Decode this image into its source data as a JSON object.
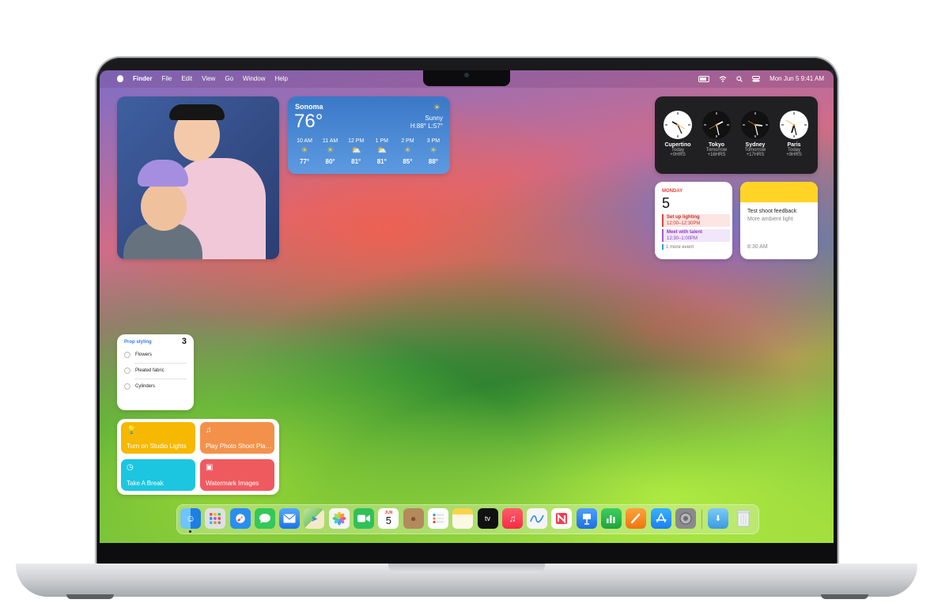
{
  "menubar": {
    "app_name": "Finder",
    "menus": [
      "File",
      "Edit",
      "View",
      "Go",
      "Window",
      "Help"
    ],
    "datetime": "Mon Jun 5  9:41 AM"
  },
  "weather": {
    "city": "Sonoma",
    "temp": "76°",
    "condition": "Sunny",
    "hilo": "H:88° L:57°",
    "hours": [
      {
        "time": "10 AM",
        "temp": "77°",
        "icon": "sun-icon"
      },
      {
        "time": "11 AM",
        "temp": "80°",
        "icon": "sun-icon"
      },
      {
        "time": "12 PM",
        "temp": "81°",
        "icon": "partly-cloudy-icon"
      },
      {
        "time": "1 PM",
        "temp": "81°",
        "icon": "partly-cloudy-icon"
      },
      {
        "time": "2 PM",
        "temp": "85°",
        "icon": "sun-icon"
      },
      {
        "time": "3 PM",
        "temp": "88°",
        "icon": "sun-icon"
      }
    ]
  },
  "clocks": [
    {
      "city": "Cupertino",
      "day": "Today",
      "offset": "+0HRS"
    },
    {
      "city": "Tokyo",
      "day": "Tomorrow",
      "offset": "+16HRS"
    },
    {
      "city": "Sydney",
      "day": "Tomorrow",
      "offset": "+17HRS"
    },
    {
      "city": "Paris",
      "day": "Today",
      "offset": "+9HRS"
    }
  ],
  "calendar": {
    "weekday": "MONDAY",
    "day": "5",
    "events": [
      {
        "name": "Set up lighting",
        "time": "12:00–12:30PM",
        "color": "#e6443a"
      },
      {
        "name": "Meet with talent",
        "time": "12:30–1:00PM",
        "color": "#a35bd6"
      }
    ],
    "more": "1 more event"
  },
  "notes": {
    "title": "Test shoot feedback",
    "body": "More ambient light",
    "time": "8:30 AM"
  },
  "reminders": {
    "list": "Prop styling",
    "count": "3",
    "items": [
      "Flowers",
      "Pleated fabric",
      "Cylinders"
    ]
  },
  "shortcuts": [
    {
      "label": "Turn on Studio Lights",
      "icon": "lightbulb-icon",
      "color": "#f6b800"
    },
    {
      "label": "Play Photo Shoot Playlist",
      "icon": "music-note-icon",
      "color": "#f3914a"
    },
    {
      "label": "Take A Break",
      "icon": "timer-icon",
      "color": "#1cc6e0"
    },
    {
      "label": "Watermark Images",
      "icon": "image-icon",
      "color": "#ef5a5f"
    }
  ],
  "dock": {
    "calendar_month": "JUN",
    "calendar_day": "5",
    "tv_label": "tv",
    "apps": [
      {
        "name": "finder-icon",
        "color": "#2f8be8"
      },
      {
        "name": "launchpad-icon",
        "color": "#d8d8dc"
      },
      {
        "name": "safari-icon",
        "color": "#2a8ef0"
      },
      {
        "name": "messages-icon",
        "color": "#34c759"
      },
      {
        "name": "mail-icon",
        "color": "#3a8ef5"
      },
      {
        "name": "maps-icon",
        "color": "#7ec86a"
      },
      {
        "name": "photos-icon",
        "color": "#f5f5f5"
      },
      {
        "name": "facetime-icon",
        "color": "#30c159"
      },
      {
        "name": "calendar-icon",
        "color": "#ffffff"
      },
      {
        "name": "contacts-icon",
        "color": "#b48a5c"
      },
      {
        "name": "reminders-icon",
        "color": "#ffffff"
      },
      {
        "name": "notes-icon",
        "color": "#fbe48a"
      },
      {
        "name": "tv-icon",
        "color": "#111111"
      },
      {
        "name": "music-icon",
        "color": "#fa3b4f"
      },
      {
        "name": "freeform-icon",
        "color": "#f5f5f5"
      },
      {
        "name": "news-icon",
        "color": "#fa3b4f"
      },
      {
        "name": "keynote-icon",
        "color": "#3b8ef0"
      },
      {
        "name": "numbers-icon",
        "color": "#2cb84c"
      },
      {
        "name": "pages-icon",
        "color": "#f58a1f"
      },
      {
        "name": "app-store-icon",
        "color": "#1f8bf5"
      },
      {
        "name": "system-settings-icon",
        "color": "#8a8a8e"
      }
    ],
    "downloads": {
      "name": "downloads-folder-icon",
      "color": "#5ab4ee"
    },
    "trash": {
      "name": "trash-icon",
      "color": "#e8eef2"
    }
  }
}
